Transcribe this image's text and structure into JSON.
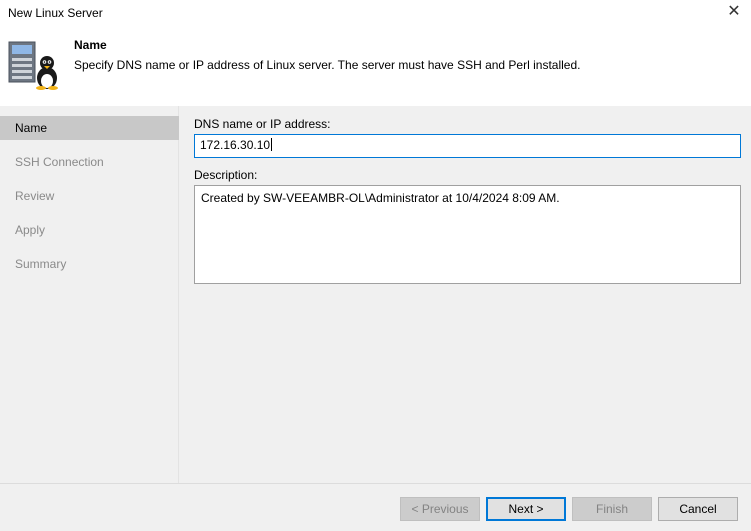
{
  "window": {
    "title": "New Linux Server",
    "close_icon": "close-icon"
  },
  "header": {
    "title": "Name",
    "description": "Specify DNS name or IP address of Linux server. The server must have SSH and Perl installed.",
    "icon": "linux-server-icon"
  },
  "steps": [
    {
      "label": "Name",
      "active": true
    },
    {
      "label": "SSH Connection",
      "active": false
    },
    {
      "label": "Review",
      "active": false
    },
    {
      "label": "Apply",
      "active": false
    },
    {
      "label": "Summary",
      "active": false
    }
  ],
  "form": {
    "dns_label": "DNS name or IP address:",
    "dns_value": "172.16.30.10",
    "description_label": "Description:",
    "description_value": "Created by SW-VEEAMBR-OL\\Administrator at 10/4/2024 8:09 AM."
  },
  "buttons": {
    "previous": "< Previous",
    "next": "Next >",
    "finish": "Finish",
    "cancel": "Cancel"
  },
  "colors": {
    "accent": "#0078d7",
    "active_step_bg": "#c8c8c8",
    "inactive_step_text": "#8a8a8a"
  }
}
